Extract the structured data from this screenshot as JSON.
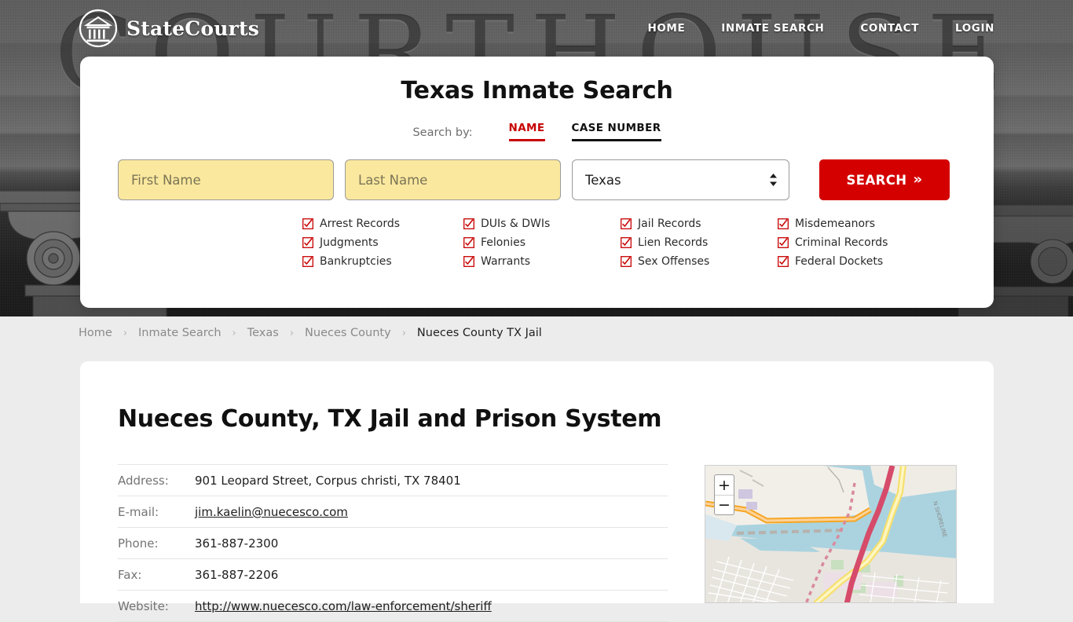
{
  "brand": {
    "name": "StateCourts",
    "logo_icon": "courthouse-circle-icon"
  },
  "nav": {
    "items": [
      {
        "label": "HOME"
      },
      {
        "label": "INMATE SEARCH"
      },
      {
        "label": "CONTACT"
      },
      {
        "label": "LOGIN"
      }
    ]
  },
  "hero": {
    "background_word": "COURTHOUSE"
  },
  "search": {
    "title": "Texas Inmate Search",
    "search_by_label": "Search by:",
    "tabs": [
      {
        "label": "NAME",
        "active": true
      },
      {
        "label": "CASE NUMBER",
        "active": false
      }
    ],
    "first_name": {
      "value": "",
      "placeholder": "First Name"
    },
    "last_name": {
      "value": "",
      "placeholder": "Last Name"
    },
    "state": {
      "value": "Texas"
    },
    "button_label": "SEARCH",
    "button_chevron": "»",
    "checkbox_glyph": "checkmark-box-icon",
    "record_types": [
      "Arrest Records",
      "DUIs & DWIs",
      "Jail Records",
      "Misdemeanors",
      "Judgments",
      "Felonies",
      "Lien Records",
      "Criminal Records",
      "Bankruptcies",
      "Warrants",
      "Sex Offenses",
      "Federal Dockets"
    ]
  },
  "breadcrumb": {
    "separator": "›",
    "items": [
      {
        "label": "Home",
        "current": false
      },
      {
        "label": "Inmate Search",
        "current": false
      },
      {
        "label": "Texas",
        "current": false
      },
      {
        "label": "Nueces County",
        "current": false
      },
      {
        "label": "Nueces County TX Jail",
        "current": true
      }
    ]
  },
  "page": {
    "title": "Nueces County, TX Jail and Prison System",
    "details": [
      {
        "label": "Address:",
        "value": "901 Leopard Street, Corpus christi, TX 78401",
        "link": false
      },
      {
        "label": "E-mail:",
        "value": "jim.kaelin@nuecesco.com",
        "link": true
      },
      {
        "label": "Phone:",
        "value": "361-887-2300",
        "link": false
      },
      {
        "label": "Fax:",
        "value": "361-887-2206",
        "link": false
      },
      {
        "label": "Website:",
        "value": "http://www.nuecesco.com/law-enforcement/sheriff",
        "link": true
      }
    ]
  },
  "map": {
    "zoom_in_label": "+",
    "zoom_out_label": "−"
  },
  "colors": {
    "accent_red": "#c70101",
    "button_red": "#d40000",
    "input_yellow": "#fae89e",
    "page_bg": "#ececec"
  }
}
